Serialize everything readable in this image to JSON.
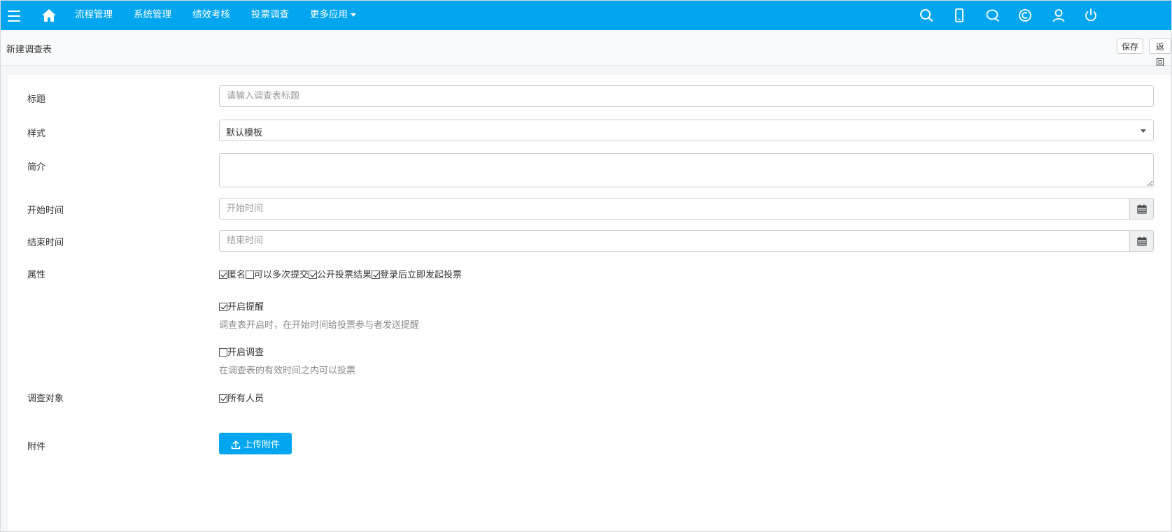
{
  "nav": {
    "items": [
      "流程管理",
      "系统管理",
      "绩效考核",
      "投票调查",
      "更多应用"
    ],
    "icons": [
      "menu-icon",
      "home-icon",
      "search-icon",
      "mobile-icon",
      "chat-icon",
      "copyright-icon",
      "user-icon",
      "power-icon"
    ]
  },
  "header": {
    "title": "新建调查表",
    "save_label": "保存",
    "back_label": "返回"
  },
  "form": {
    "title_label": "标题",
    "title_placeholder": "请输入调查表标题",
    "style_label": "样式",
    "style_value": "默认模板",
    "intro_label": "简介",
    "start_label": "开始时间",
    "start_placeholder": "开始时间",
    "end_label": "结束时间",
    "end_placeholder": "结束时间",
    "attr_label": "属性",
    "attr_options": [
      {
        "label": "匿名",
        "checked": true
      },
      {
        "label": "可以多次提交",
        "checked": false
      },
      {
        "label": "公开投票结果",
        "checked": true
      },
      {
        "label": "登录后立即发起投票",
        "checked": true
      }
    ],
    "reminder": {
      "label": "开启提醒",
      "checked": true,
      "hint": "调查表开启时，在开始时间给投票参与者发送提醒"
    },
    "survey": {
      "label": "开启调查",
      "checked": false,
      "hint": "在调查表的有效时间之内可以投票"
    },
    "target_label": "调查对象",
    "target_option": {
      "label": "所有人员",
      "checked": true
    },
    "attach_label": "附件",
    "upload_label": "上传附件"
  },
  "colors": {
    "primary": "#02a6ef",
    "page_bg": "#f5f6f8"
  }
}
